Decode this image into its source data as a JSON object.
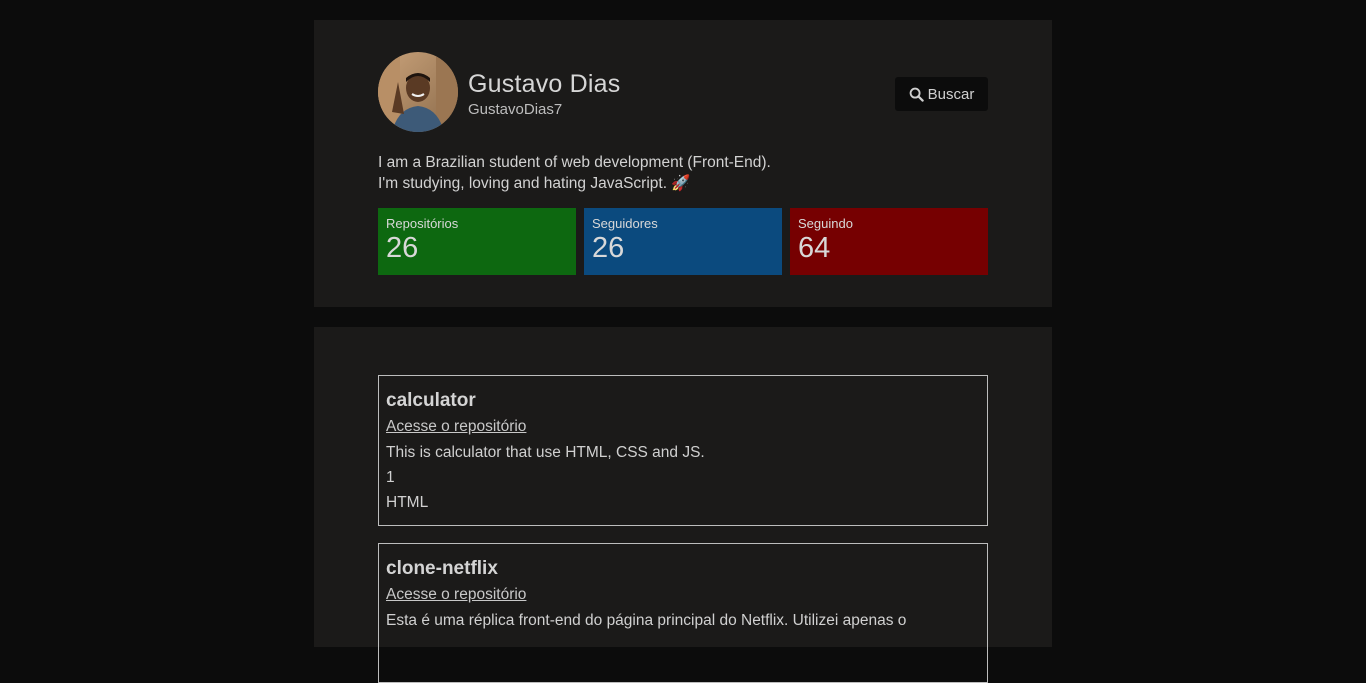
{
  "profile": {
    "name": "Gustavo Dias",
    "username": "GustavoDias7",
    "bio_line1": "I am a Brazilian student of web development (Front-End).",
    "bio_line2": "I'm studying, loving and hating JavaScript. 🚀",
    "search_label": "Buscar",
    "search_icon": "search-icon",
    "stats": {
      "repos": {
        "label": "Repositórios",
        "value": "26",
        "color": "#0d6810"
      },
      "followers": {
        "label": "Seguidores",
        "value": "26",
        "color": "#0b4a7e"
      },
      "following": {
        "label": "Seguindo",
        "value": "64",
        "color": "#760001"
      }
    }
  },
  "repos": [
    {
      "name": "calculator",
      "link_label": "Acesse o repositório",
      "description": "This is calculator that use HTML, CSS and JS.",
      "stars": "1",
      "language": "HTML"
    },
    {
      "name": "clone-netflix",
      "link_label": "Acesse o repositório",
      "description": "Esta é uma réplica front-end do página principal do Netflix. Utilizei apenas o"
    }
  ]
}
